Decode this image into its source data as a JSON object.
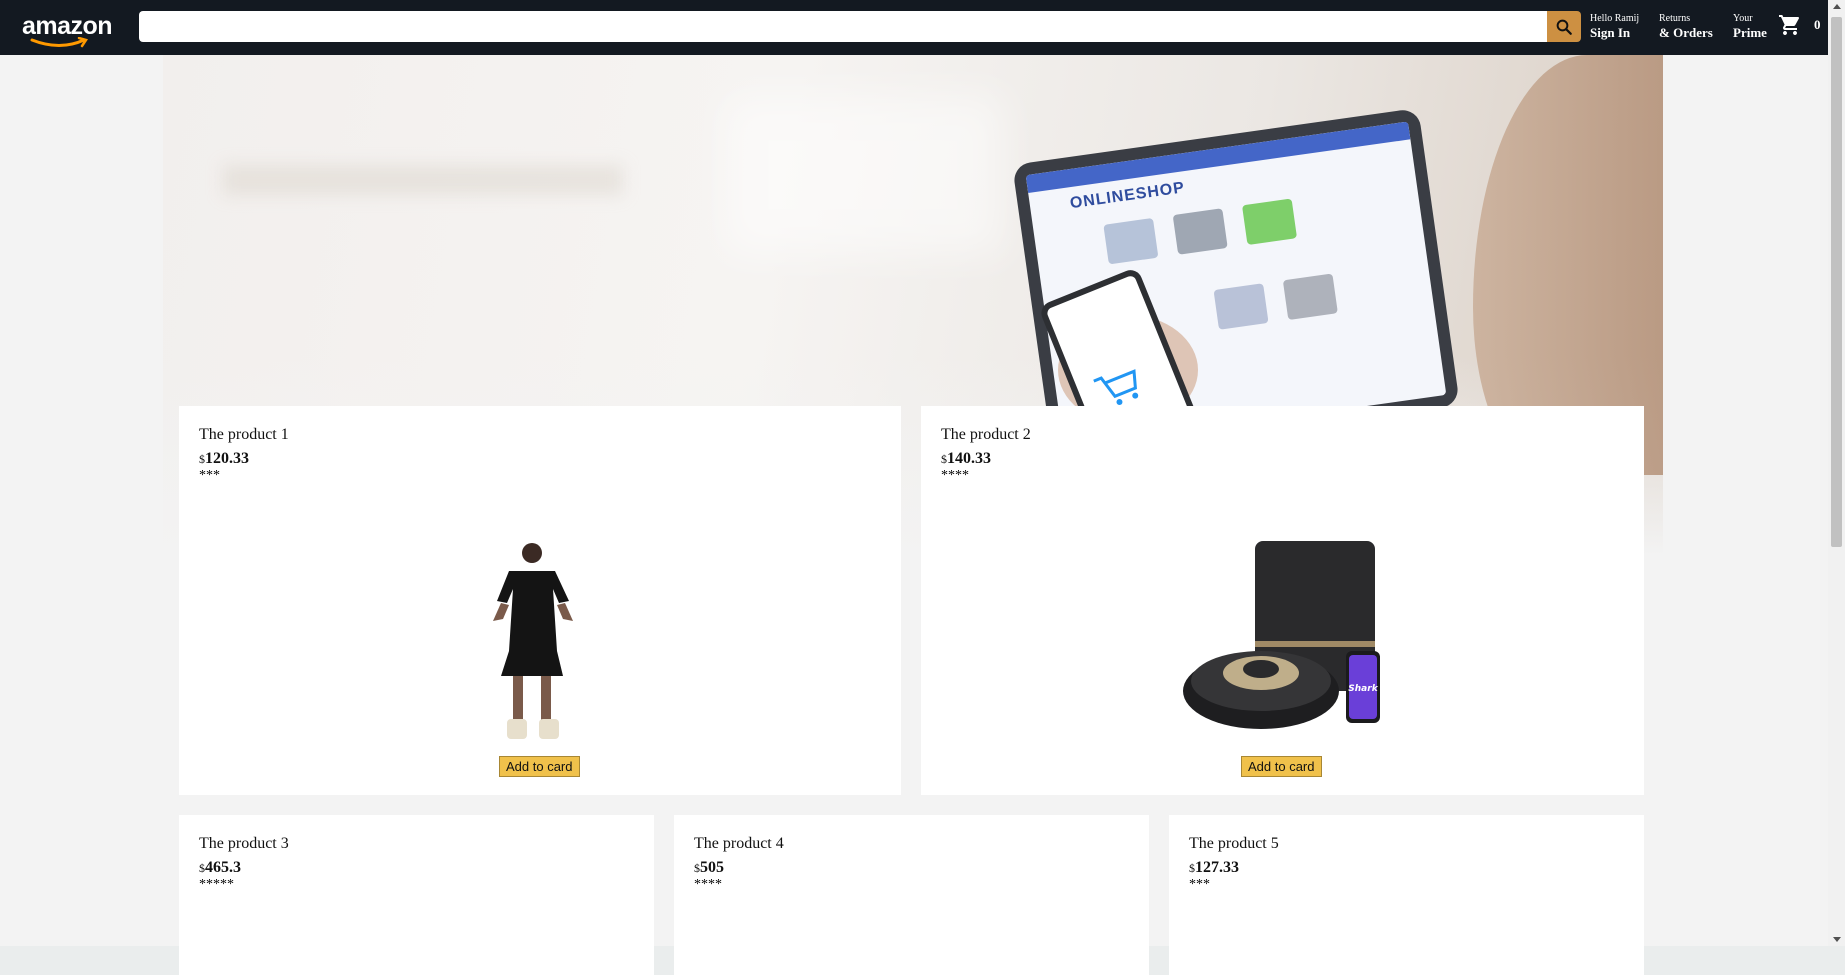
{
  "header": {
    "logo": "amazon",
    "search": {
      "value": "",
      "placeholder": ""
    },
    "nav": [
      {
        "line1": "Hello Ramij",
        "line2": "Sign In"
      },
      {
        "line1": "Returns",
        "line2": "& Orders"
      },
      {
        "line1": "Your",
        "line2": "Prime"
      }
    ],
    "basket_count": "0"
  },
  "hero": {
    "screen_title": "ONLINESHOP"
  },
  "products": [
    {
      "title": "The product 1",
      "currency": "$",
      "price": "120.33",
      "rating": "***",
      "button": "Add to card"
    },
    {
      "title": "The product 2",
      "currency": "$",
      "price": "140.33",
      "rating": "****",
      "button": "Add to card"
    },
    {
      "title": "The product 3",
      "currency": "$",
      "price": "465.3",
      "rating": "*****"
    },
    {
      "title": "The product 4",
      "currency": "$",
      "price": "505",
      "rating": "****"
    },
    {
      "title": "The product 5",
      "currency": "$",
      "price": "127.33",
      "rating": "***"
    }
  ],
  "colors": {
    "header_bg": "#131921",
    "search_button": "#cd9042",
    "add_button": "#f0c14b"
  }
}
